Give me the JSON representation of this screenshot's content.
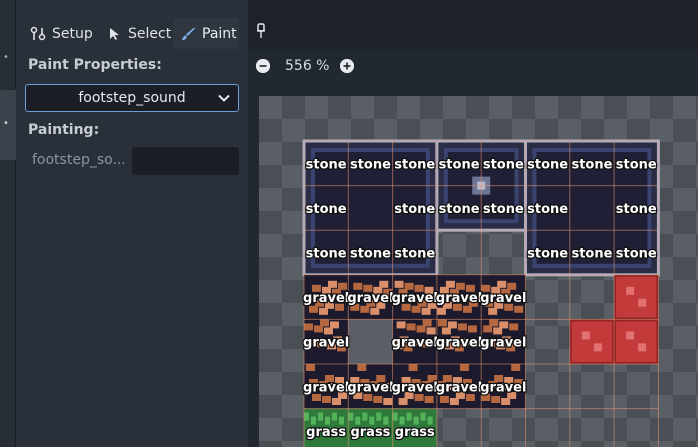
{
  "tabs": [
    {
      "label": "Setup",
      "icon": "setup-icon",
      "active": false
    },
    {
      "label": "Select",
      "icon": "cursor-icon",
      "active": false
    },
    {
      "label": "Paint",
      "icon": "brush-icon",
      "active": true
    }
  ],
  "paint_properties": {
    "title": "Paint Properties:",
    "selected": "footstep_sound"
  },
  "painting": {
    "title": "Painting:",
    "property_name": "footstep_so...",
    "property_value": ""
  },
  "zoom": {
    "level": "556 %"
  },
  "colors": {
    "accent": "#6b9ed6",
    "background": "#1d2229",
    "panel": "#2a3039",
    "tile_label": "#ffffff"
  },
  "tile_grid": {
    "rows": [
      [
        "stone",
        "stone",
        "stone",
        "stone",
        "stone",
        "stone",
        "stone",
        "stone"
      ],
      [
        "stone",
        "",
        "stone",
        "stone",
        "stone",
        "stone",
        "",
        "stone"
      ],
      [
        "stone",
        "stone",
        "stone",
        "",
        "",
        "stone",
        "stone",
        "stone"
      ],
      [
        "gravel",
        "gravel",
        "gravel",
        "gravel",
        "gravel",
        "",
        "",
        ""
      ],
      [
        "gravel",
        "",
        "gravel",
        "gravel",
        "gravel",
        "",
        "",
        ""
      ],
      [
        "gravel",
        "gravel",
        "gravel",
        "gravel",
        "gravel",
        "",
        "",
        ""
      ],
      [
        "grass",
        "grass",
        "grass",
        "",
        "",
        "",
        "",
        ""
      ]
    ]
  }
}
